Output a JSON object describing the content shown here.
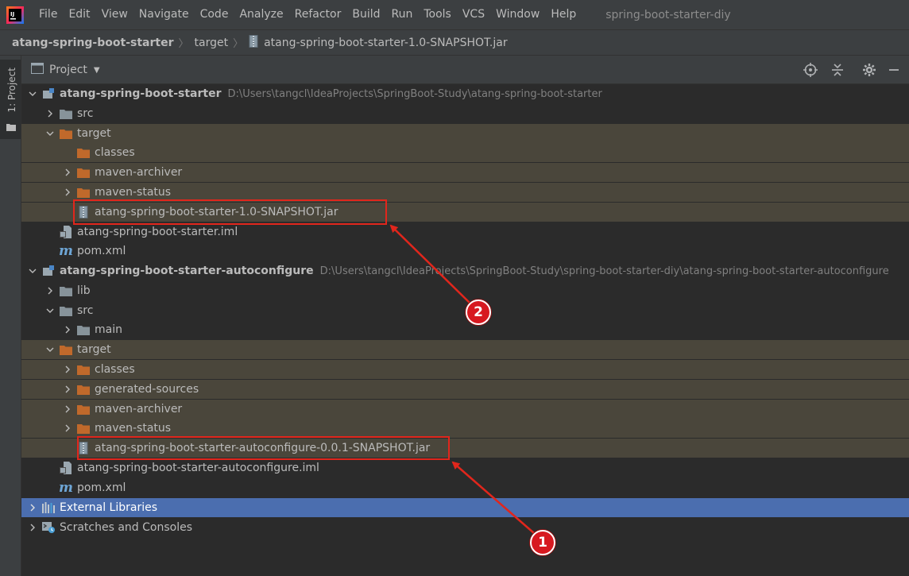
{
  "menubar": {
    "items": [
      "File",
      "Edit",
      "View",
      "Navigate",
      "Code",
      "Analyze",
      "Refactor",
      "Build",
      "Run",
      "Tools",
      "VCS",
      "Window",
      "Help"
    ],
    "window_title": "spring-boot-starter-diy"
  },
  "breadcrumbs": [
    "atang-spring-boot-starter",
    "target",
    "atang-spring-boot-starter-1.0-SNAPSHOT.jar"
  ],
  "left_strip": {
    "tab_label": "1: Project"
  },
  "panel": {
    "title": "Project"
  },
  "tree": {
    "rows": [
      {
        "label": "atang-spring-boot-starter",
        "path": "D:\\Users\\tangcl\\IdeaProjects\\SpringBoot-Study\\atang-spring-boot-starter"
      },
      {
        "label": "src"
      },
      {
        "label": "target"
      },
      {
        "label": "classes"
      },
      {
        "label": "maven-archiver"
      },
      {
        "label": "maven-status"
      },
      {
        "label": "atang-spring-boot-starter-1.0-SNAPSHOT.jar"
      },
      {
        "label": "atang-spring-boot-starter.iml"
      },
      {
        "label": "pom.xml"
      },
      {
        "label": "atang-spring-boot-starter-autoconfigure",
        "path": "D:\\Users\\tangcl\\IdeaProjects\\SpringBoot-Study\\spring-boot-starter-diy\\atang-spring-boot-starter-autoconfigure"
      },
      {
        "label": "lib"
      },
      {
        "label": "src"
      },
      {
        "label": "main"
      },
      {
        "label": "target"
      },
      {
        "label": "classes"
      },
      {
        "label": "generated-sources"
      },
      {
        "label": "maven-archiver"
      },
      {
        "label": "maven-status"
      },
      {
        "label": "atang-spring-boot-starter-autoconfigure-0.0.1-SNAPSHOT.jar"
      },
      {
        "label": "atang-spring-boot-starter-autoconfigure.iml"
      },
      {
        "label": "pom.xml"
      },
      {
        "label": "External Libraries"
      },
      {
        "label": "Scratches and Consoles"
      }
    ]
  },
  "annotations": {
    "badge_1": "1",
    "badge_2": "2",
    "color": "#e1261c"
  }
}
